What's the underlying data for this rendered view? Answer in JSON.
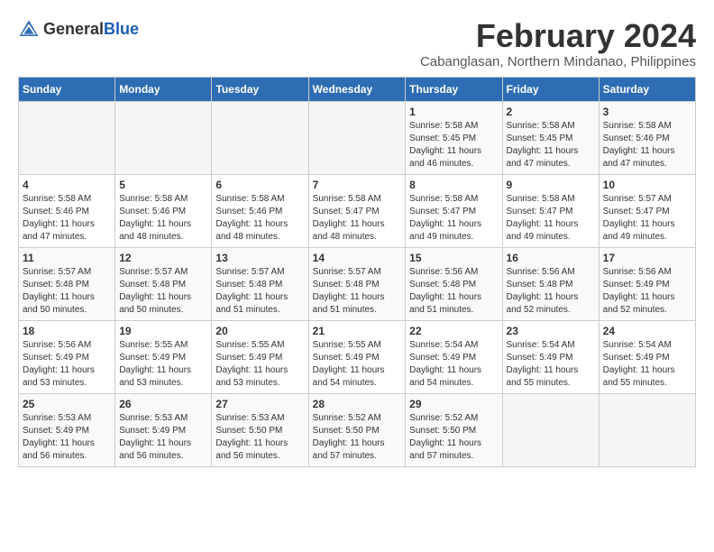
{
  "header": {
    "logo_general": "General",
    "logo_blue": "Blue",
    "month_title": "February 2024",
    "subtitle": "Cabanglasan, Northern Mindanao, Philippines"
  },
  "weekdays": [
    "Sunday",
    "Monday",
    "Tuesday",
    "Wednesday",
    "Thursday",
    "Friday",
    "Saturday"
  ],
  "weeks": [
    [
      {
        "day": "",
        "info": ""
      },
      {
        "day": "",
        "info": ""
      },
      {
        "day": "",
        "info": ""
      },
      {
        "day": "",
        "info": ""
      },
      {
        "day": "1",
        "info": "Sunrise: 5:58 AM\nSunset: 5:45 PM\nDaylight: 11 hours and 46 minutes."
      },
      {
        "day": "2",
        "info": "Sunrise: 5:58 AM\nSunset: 5:45 PM\nDaylight: 11 hours and 47 minutes."
      },
      {
        "day": "3",
        "info": "Sunrise: 5:58 AM\nSunset: 5:46 PM\nDaylight: 11 hours and 47 minutes."
      }
    ],
    [
      {
        "day": "4",
        "info": "Sunrise: 5:58 AM\nSunset: 5:46 PM\nDaylight: 11 hours and 47 minutes."
      },
      {
        "day": "5",
        "info": "Sunrise: 5:58 AM\nSunset: 5:46 PM\nDaylight: 11 hours and 48 minutes."
      },
      {
        "day": "6",
        "info": "Sunrise: 5:58 AM\nSunset: 5:46 PM\nDaylight: 11 hours and 48 minutes."
      },
      {
        "day": "7",
        "info": "Sunrise: 5:58 AM\nSunset: 5:47 PM\nDaylight: 11 hours and 48 minutes."
      },
      {
        "day": "8",
        "info": "Sunrise: 5:58 AM\nSunset: 5:47 PM\nDaylight: 11 hours and 49 minutes."
      },
      {
        "day": "9",
        "info": "Sunrise: 5:58 AM\nSunset: 5:47 PM\nDaylight: 11 hours and 49 minutes."
      },
      {
        "day": "10",
        "info": "Sunrise: 5:57 AM\nSunset: 5:47 PM\nDaylight: 11 hours and 49 minutes."
      }
    ],
    [
      {
        "day": "11",
        "info": "Sunrise: 5:57 AM\nSunset: 5:48 PM\nDaylight: 11 hours and 50 minutes."
      },
      {
        "day": "12",
        "info": "Sunrise: 5:57 AM\nSunset: 5:48 PM\nDaylight: 11 hours and 50 minutes."
      },
      {
        "day": "13",
        "info": "Sunrise: 5:57 AM\nSunset: 5:48 PM\nDaylight: 11 hours and 51 minutes."
      },
      {
        "day": "14",
        "info": "Sunrise: 5:57 AM\nSunset: 5:48 PM\nDaylight: 11 hours and 51 minutes."
      },
      {
        "day": "15",
        "info": "Sunrise: 5:56 AM\nSunset: 5:48 PM\nDaylight: 11 hours and 51 minutes."
      },
      {
        "day": "16",
        "info": "Sunrise: 5:56 AM\nSunset: 5:48 PM\nDaylight: 11 hours and 52 minutes."
      },
      {
        "day": "17",
        "info": "Sunrise: 5:56 AM\nSunset: 5:49 PM\nDaylight: 11 hours and 52 minutes."
      }
    ],
    [
      {
        "day": "18",
        "info": "Sunrise: 5:56 AM\nSunset: 5:49 PM\nDaylight: 11 hours and 53 minutes."
      },
      {
        "day": "19",
        "info": "Sunrise: 5:55 AM\nSunset: 5:49 PM\nDaylight: 11 hours and 53 minutes."
      },
      {
        "day": "20",
        "info": "Sunrise: 5:55 AM\nSunset: 5:49 PM\nDaylight: 11 hours and 53 minutes."
      },
      {
        "day": "21",
        "info": "Sunrise: 5:55 AM\nSunset: 5:49 PM\nDaylight: 11 hours and 54 minutes."
      },
      {
        "day": "22",
        "info": "Sunrise: 5:54 AM\nSunset: 5:49 PM\nDaylight: 11 hours and 54 minutes."
      },
      {
        "day": "23",
        "info": "Sunrise: 5:54 AM\nSunset: 5:49 PM\nDaylight: 11 hours and 55 minutes."
      },
      {
        "day": "24",
        "info": "Sunrise: 5:54 AM\nSunset: 5:49 PM\nDaylight: 11 hours and 55 minutes."
      }
    ],
    [
      {
        "day": "25",
        "info": "Sunrise: 5:53 AM\nSunset: 5:49 PM\nDaylight: 11 hours and 56 minutes."
      },
      {
        "day": "26",
        "info": "Sunrise: 5:53 AM\nSunset: 5:49 PM\nDaylight: 11 hours and 56 minutes."
      },
      {
        "day": "27",
        "info": "Sunrise: 5:53 AM\nSunset: 5:50 PM\nDaylight: 11 hours and 56 minutes."
      },
      {
        "day": "28",
        "info": "Sunrise: 5:52 AM\nSunset: 5:50 PM\nDaylight: 11 hours and 57 minutes."
      },
      {
        "day": "29",
        "info": "Sunrise: 5:52 AM\nSunset: 5:50 PM\nDaylight: 11 hours and 57 minutes."
      },
      {
        "day": "",
        "info": ""
      },
      {
        "day": "",
        "info": ""
      }
    ]
  ]
}
